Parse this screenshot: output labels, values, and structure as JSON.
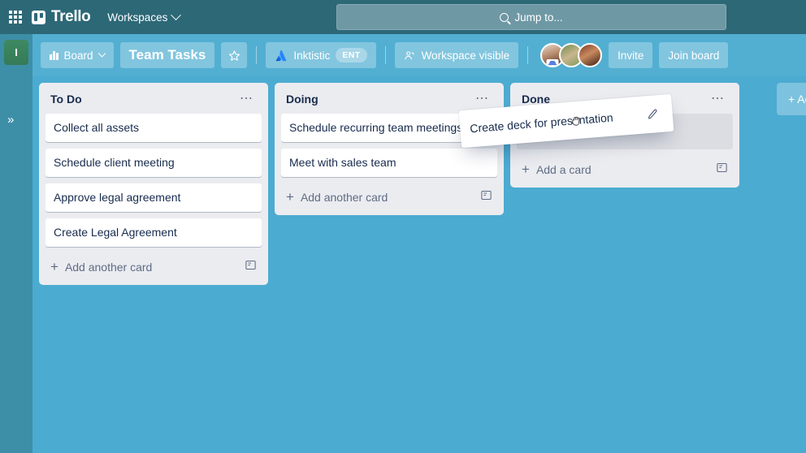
{
  "topbar": {
    "apps_icon": "apps-grid-icon",
    "brand": "Trello",
    "workspaces_label": "Workspaces",
    "search_placeholder": "Jump to...",
    "search_icon": "search-icon",
    "background": "#2D6877"
  },
  "sidebar": {
    "workspace_initial": "I",
    "expand_label": "»",
    "background": "#3D8FA8"
  },
  "board_header": {
    "view_label": "Board",
    "board_title": "Team Tasks",
    "star_icon": "star-icon",
    "workspace_name": "Inktistic",
    "workspace_badge": "ENT",
    "visibility_label": "Workspace visible",
    "invite_label": "Invite",
    "join_label": "Join board",
    "members": [
      "member-avatar-1",
      "member-avatar-2",
      "member-avatar-3"
    ],
    "background": "#52AFD2"
  },
  "board": {
    "background": "#4BABD1",
    "add_list_label": "+ Add another list",
    "lists": [
      {
        "title": "To Do",
        "menu_icon": "list-menu-icon",
        "cards": [
          "Collect all assets",
          "Schedule client meeting",
          "Approve legal agreement",
          "Create Legal Agreement"
        ],
        "add_card_label": "Add another card",
        "template_icon": "card-template-icon",
        "has_placeholder": false
      },
      {
        "title": "Doing",
        "menu_icon": "list-menu-icon",
        "cards": [
          "Schedule recurring team meetings",
          "Meet with sales team"
        ],
        "add_card_label": "Add another card",
        "template_icon": "card-template-icon",
        "has_placeholder": false
      },
      {
        "title": "Done",
        "menu_icon": "list-menu-icon",
        "cards": [],
        "add_card_label": "Add a card",
        "template_icon": "card-template-icon",
        "has_placeholder": true
      }
    ]
  },
  "drag": {
    "card_text": "Create deck for presentation",
    "edit_icon": "pencil-edit-icon",
    "cursor_icon": "grabbing-hand-cursor"
  }
}
